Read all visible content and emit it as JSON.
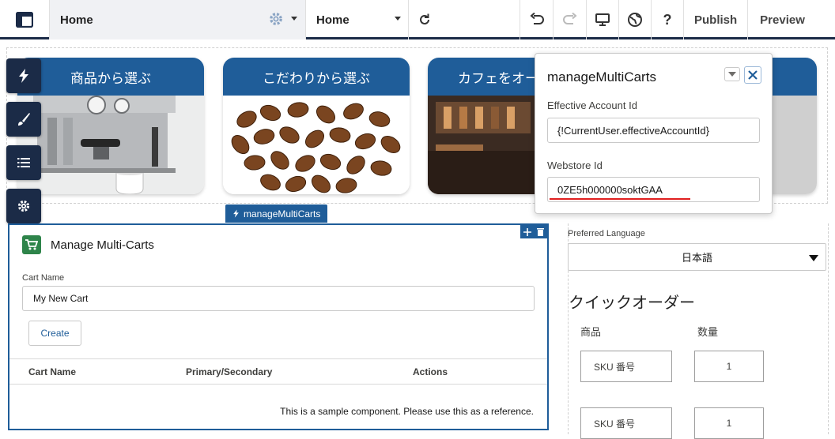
{
  "topbar": {
    "page_selector": "Home",
    "page_dropdown": "Home",
    "publish_label": "Publish",
    "preview_label": "Preview",
    "accent": "#1b2b47"
  },
  "tiles": [
    {
      "label": "商品から選ぶ",
      "image": "espresso-machine"
    },
    {
      "label": "こだわりから選ぶ",
      "image": "coffee-beans"
    },
    {
      "label": "カフェをオー",
      "image": "cafe-interior"
    }
  ],
  "side_tools": [
    "lightning-icon",
    "brush-icon",
    "list-icon",
    "gear-icon"
  ],
  "popup": {
    "title": "manageMultiCarts",
    "effective_account_label": "Effective Account Id",
    "effective_account_value": "{!CurrentUser.effectiveAccountId}",
    "webstore_label": "Webstore Id",
    "webstore_value": "0ZE5h000000soktGAA"
  },
  "component_tag": "manageMultiCarts",
  "manage_carts": {
    "title": "Manage Multi-Carts",
    "cart_name_label": "Cart Name",
    "cart_name_value": "My New Cart",
    "create_label": "Create",
    "columns": [
      "Cart Name",
      "Primary/Secondary",
      "Actions"
    ],
    "note": "This is a sample component. Please use this as a reference.",
    "brand_color": "#1f5d99",
    "cart_icon_color": "#2e844a"
  },
  "preferred_language": {
    "label": "Preferred Language",
    "value": "日本語"
  },
  "quick_order": {
    "title": "クイックオーダー",
    "product_header": "商品",
    "quantity_header": "数量",
    "rows": [
      {
        "sku_placeholder": "SKU 番号",
        "qty": "1"
      },
      {
        "sku_placeholder": "SKU 番号",
        "qty": "1"
      }
    ]
  }
}
